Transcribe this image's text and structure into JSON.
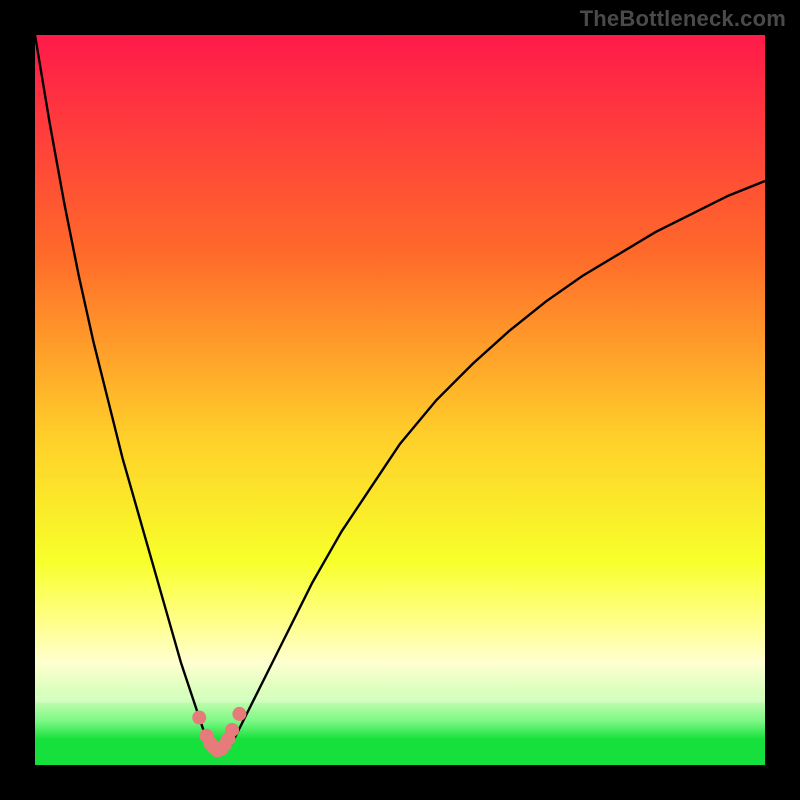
{
  "watermark": "TheBottleneck.com",
  "colors": {
    "frame_bg": "#000000",
    "watermark": "#4a4a4a",
    "curve_stroke": "#000000",
    "dots_fill": "#e77b7b",
    "green_band": "#16e03b"
  },
  "chart_data": {
    "type": "line",
    "title": "",
    "xlabel": "",
    "ylabel": "",
    "xlim": [
      0,
      100
    ],
    "ylim": [
      0,
      100
    ],
    "x": [
      0,
      2,
      4,
      6,
      8,
      10,
      12,
      14,
      16,
      18,
      20,
      21,
      22,
      23,
      24,
      25,
      26,
      27,
      28,
      30,
      32,
      34,
      36,
      38,
      40,
      42,
      44,
      46,
      48,
      50,
      55,
      60,
      65,
      70,
      75,
      80,
      85,
      90,
      95,
      100
    ],
    "series": [
      {
        "name": "bottleneck-curve",
        "values": [
          100,
          88,
          77,
          67,
          58,
          50,
          42,
          35,
          28,
          21,
          14,
          11,
          8,
          5,
          3,
          2,
          2,
          3,
          5,
          9,
          13,
          17,
          21,
          25,
          28.5,
          32,
          35,
          38,
          41,
          44,
          50,
          55,
          59.5,
          63.5,
          67,
          70,
          73,
          75.5,
          78,
          80
        ]
      }
    ],
    "dots": {
      "name": "sweet-spot-dots",
      "x": [
        22.5,
        23.5,
        24.0,
        24.5,
        25.0,
        25.5,
        26.0,
        26.5,
        27.0,
        28.0
      ],
      "y": [
        6.5,
        4.0,
        3.0,
        2.4,
        2.0,
        2.2,
        2.8,
        3.6,
        4.8,
        7.0
      ]
    },
    "gradient_stops": [
      {
        "offset": 0.0,
        "color": "#ff1a4a"
      },
      {
        "offset": 0.3,
        "color": "#ff6a2a"
      },
      {
        "offset": 0.55,
        "color": "#ffcf2a"
      },
      {
        "offset": 0.72,
        "color": "#f7ff2a"
      },
      {
        "offset": 0.8,
        "color": "#ffff85"
      },
      {
        "offset": 0.86,
        "color": "#ffffd0"
      },
      {
        "offset": 0.905,
        "color": "#d4ffba"
      },
      {
        "offset": 0.94,
        "color": "#7cf885"
      },
      {
        "offset": 0.965,
        "color": "#16e03b"
      },
      {
        "offset": 1.0,
        "color": "#16e03b"
      }
    ]
  }
}
